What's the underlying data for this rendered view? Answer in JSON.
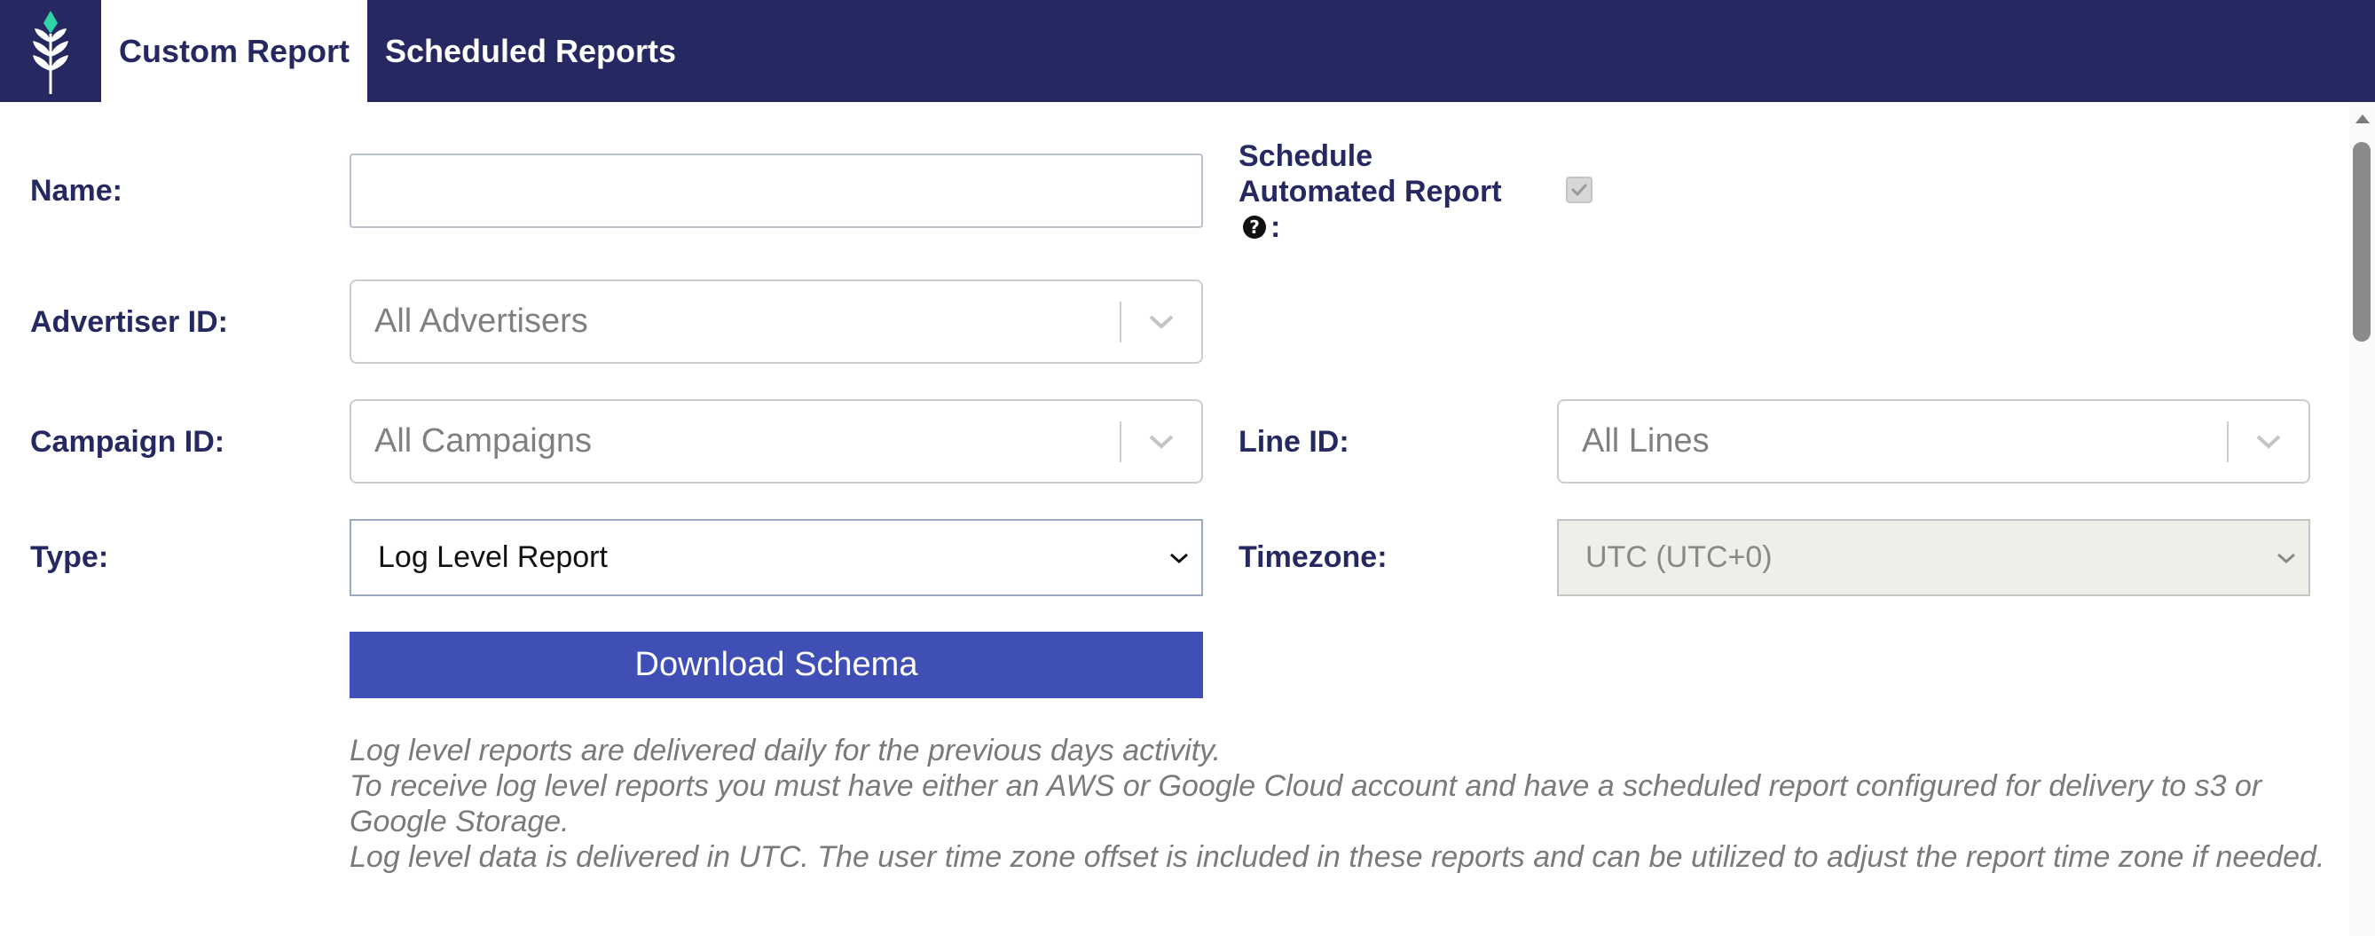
{
  "header": {
    "logo_icon": "wheat-leaf-logo-icon",
    "tabs": [
      {
        "label": "Custom Report",
        "active": true
      },
      {
        "label": "Scheduled Reports",
        "active": false
      }
    ]
  },
  "form": {
    "name": {
      "label": "Name:",
      "value": ""
    },
    "schedule": {
      "label_line1": "Schedule",
      "label_line2": "Automated Report",
      "label_suffix": ":",
      "help_icon": "question-circle-icon",
      "checked": true
    },
    "advertiser": {
      "label": "Advertiser ID:",
      "placeholder": "All Advertisers"
    },
    "campaign": {
      "label": "Campaign ID:",
      "placeholder": "All Campaigns"
    },
    "line": {
      "label": "Line ID:",
      "placeholder": "All Lines"
    },
    "type": {
      "label": "Type:",
      "value": "Log Level Report"
    },
    "timezone": {
      "label": "Timezone:",
      "value": "UTC (UTC+0)"
    },
    "download_button": "Download Schema",
    "notes": [
      "Log level reports are delivered daily for the previous days activity.",
      "To receive log level reports you must have either an AWS or Google Cloud account and have a scheduled report configured for delivery to s3 or Google Storage.",
      "Log level data is delivered in UTC. The user time zone offset is included in these reports and can be utilized to adjust the report time zone if needed."
    ]
  },
  "colors": {
    "header_bg": "#262862",
    "accent": "#3f4fb5",
    "logo_accent": "#2fd3a6",
    "label_color": "#262862"
  }
}
